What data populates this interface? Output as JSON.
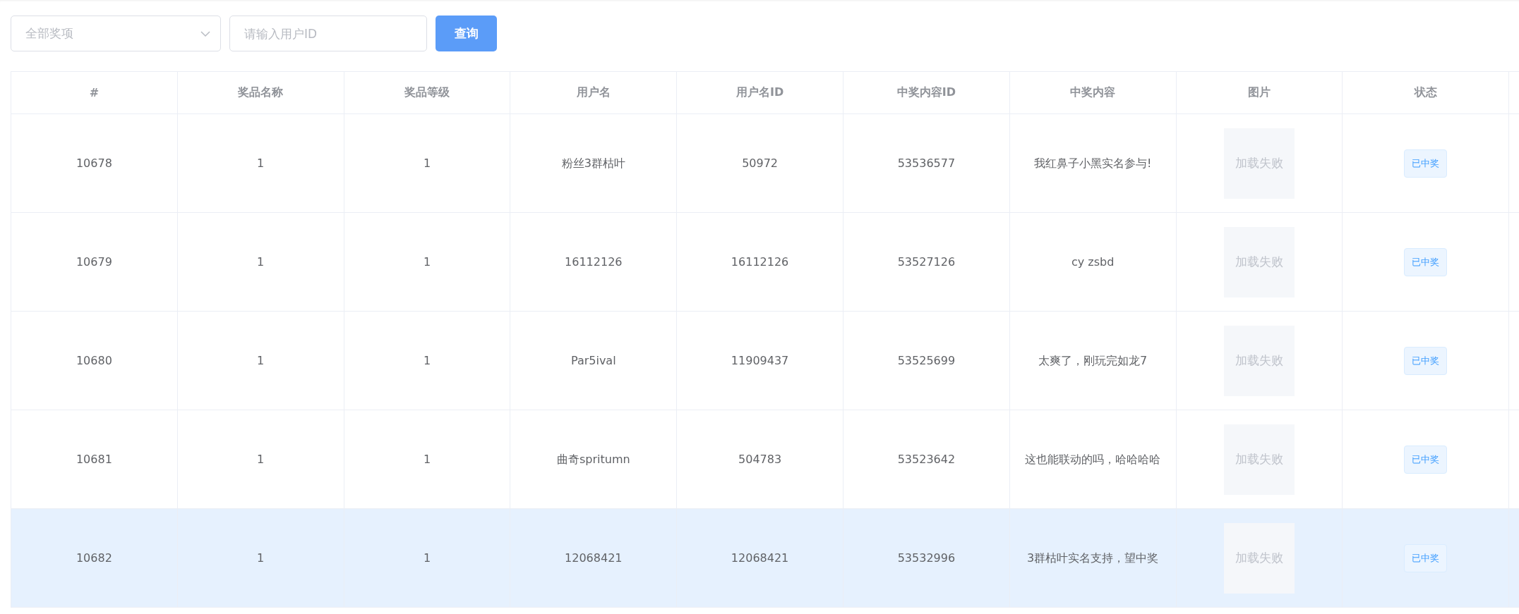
{
  "filters": {
    "prize_select": {
      "placeholder": "全部奖项"
    },
    "user_id_field": {
      "placeholder": "请输入用户ID"
    },
    "search_button": "查询"
  },
  "table": {
    "columns": [
      "#",
      "奖品名称",
      "奖品等级",
      "用户名",
      "用户名ID",
      "中奖内容ID",
      "中奖内容",
      "图片",
      "状态"
    ],
    "rows": [
      {
        "id": "10678",
        "prize_name": "1",
        "prize_level": "1",
        "username": "粉丝3群枯叶",
        "user_id": "50972",
        "content_id": "53536577",
        "content": "我红鼻子小黑实名参与!",
        "image_error": "加载失败",
        "status": "已中奖",
        "selected": false
      },
      {
        "id": "10679",
        "prize_name": "1",
        "prize_level": "1",
        "username": "16112126",
        "user_id": "16112126",
        "content_id": "53527126",
        "content": "cy zsbd",
        "image_error": "加载失败",
        "status": "已中奖",
        "selected": false
      },
      {
        "id": "10680",
        "prize_name": "1",
        "prize_level": "1",
        "username": "Par5ival",
        "user_id": "11909437",
        "content_id": "53525699",
        "content": "太爽了，刚玩完如龙7",
        "image_error": "加载失败",
        "status": "已中奖",
        "selected": false
      },
      {
        "id": "10681",
        "prize_name": "1",
        "prize_level": "1",
        "username": "曲奇spritumn",
        "user_id": "504783",
        "content_id": "53523642",
        "content": "这也能联动的吗，哈哈哈哈",
        "image_error": "加载失败",
        "status": "已中奖",
        "selected": false
      },
      {
        "id": "10682",
        "prize_name": "1",
        "prize_level": "1",
        "username": "12068421",
        "user_id": "12068421",
        "content_id": "53532996",
        "content": "3群枯叶实名支持，望中奖",
        "image_error": "加载失败",
        "status": "已中奖",
        "selected": true
      }
    ]
  }
}
